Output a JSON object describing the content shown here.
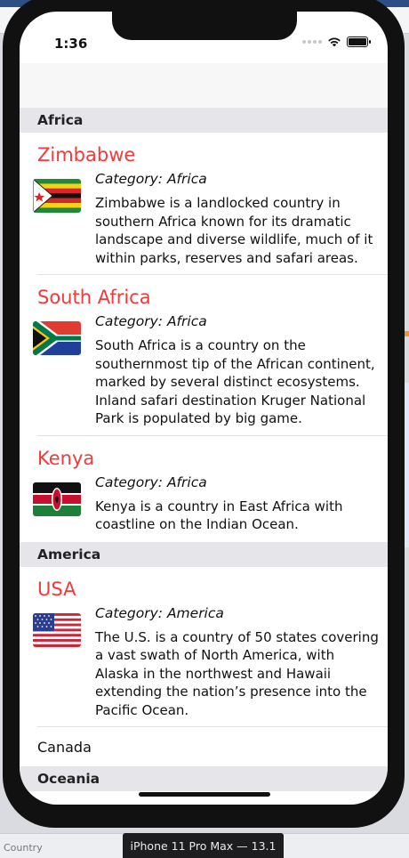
{
  "status_bar": {
    "time": "1:36"
  },
  "sections": [
    {
      "header": "Africa",
      "rows": [
        {
          "title": "Zimbabwe",
          "category": "Category: Africa",
          "description": "Zimbabwe is a landlocked country in southern Africa known for its dramatic landscape and diverse wildlife, much of it within parks, reserves and safari areas.",
          "flag": "zimbabwe-flag"
        },
        {
          "title": "South Africa",
          "category": "Category: Africa",
          "description": "South Africa is a country on the southernmost tip of the African continent, marked by several distinct ecosystems. Inland safari destination Kruger National Park is populated by big game.",
          "flag": "south-africa-flag"
        },
        {
          "title": "Kenya",
          "category": "Category: Africa",
          "description": "Kenya is a country in East Africa with coastline on the Indian Ocean.",
          "flag": "kenya-flag"
        }
      ]
    },
    {
      "header": "America",
      "rows": [
        {
          "title": "USA",
          "category": "Category: America",
          "description": "The U.S. is a country of 50 states covering a vast swath of North America, with Alaska in the northwest and Hawaii extending the nation’s presence into the Pacific Ocean.",
          "flag": "usa-flag"
        },
        {
          "title": "Canada"
        }
      ]
    },
    {
      "header": "Oceania"
    }
  ],
  "simulator": {
    "device_label": "iPhone 11 Pro Max — 13.1",
    "bottom_left_label": "Country"
  },
  "colors": {
    "title_red": "#f03b3b",
    "section_bg": "#e5e5ea"
  }
}
